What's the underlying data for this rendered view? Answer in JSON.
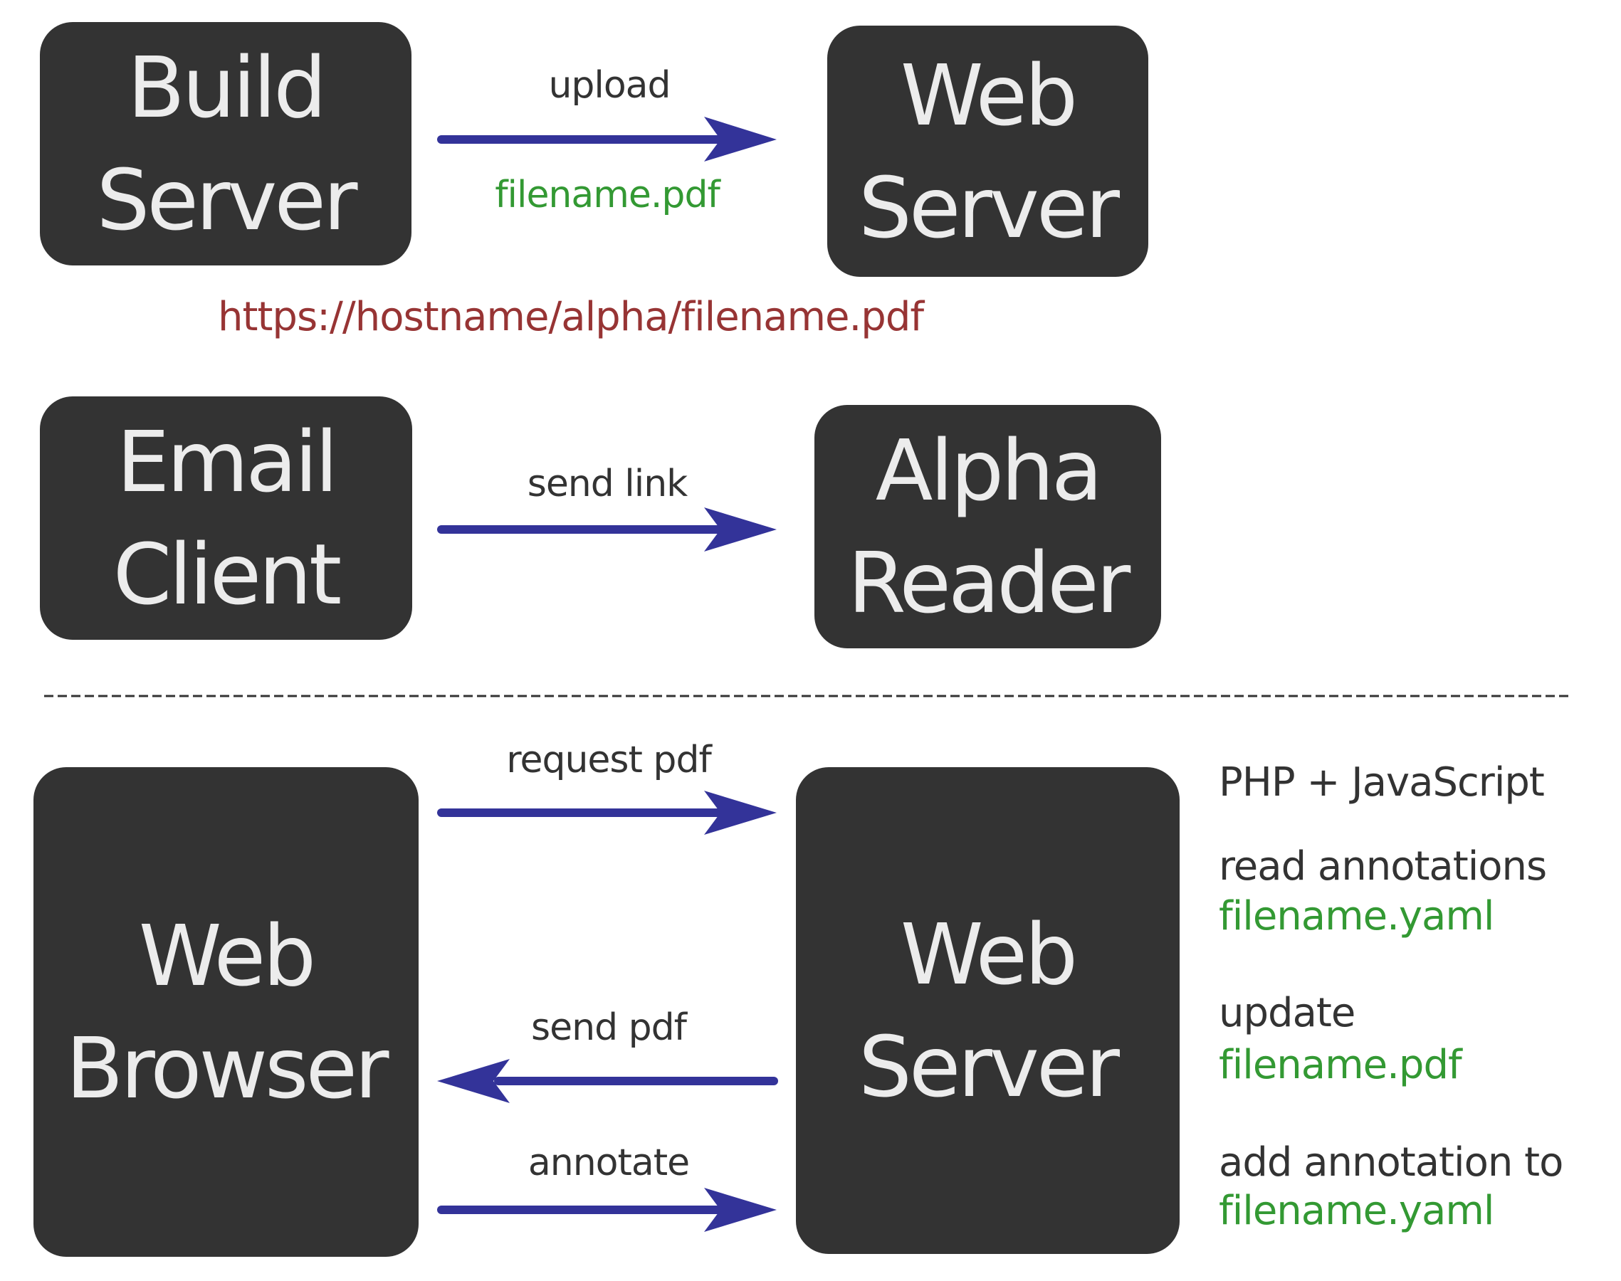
{
  "colors": {
    "node_fill": "#333333",
    "node_text": "#ececec",
    "arrow": "#333399",
    "label": "#333333",
    "filename": "#339933",
    "url": "#973434",
    "divider": "#333333"
  },
  "top_section": {
    "build_server": {
      "line1": "Build",
      "line2": "Server"
    },
    "web_server": {
      "line1": "Web",
      "line2": "Server"
    },
    "upload_arrow": {
      "label": "upload",
      "sublabel": "filename.pdf",
      "direction": "right"
    },
    "url": "https://hostname/alpha/filename.pdf",
    "email_client": {
      "line1": "Email",
      "line2": "Client"
    },
    "alpha_reader": {
      "line1": "Alpha",
      "line2": "Reader"
    },
    "send_link_arrow": {
      "label": "send link",
      "direction": "right"
    }
  },
  "bottom_section": {
    "web_browser": {
      "line1": "Web",
      "line2": "Browser"
    },
    "web_server": {
      "line1": "Web",
      "line2": "Server"
    },
    "arrows": [
      {
        "label": "request pdf",
        "direction": "right"
      },
      {
        "label": "send pdf",
        "direction": "left"
      },
      {
        "label": "annotate",
        "direction": "right"
      }
    ],
    "notes": {
      "tech": "PHP + JavaScript",
      "read_action": "read annotations",
      "read_file": "filename.yaml",
      "update_action": "update",
      "update_file": "filename.pdf",
      "add_action": "add annotation to",
      "add_file": "filename.yaml"
    }
  }
}
